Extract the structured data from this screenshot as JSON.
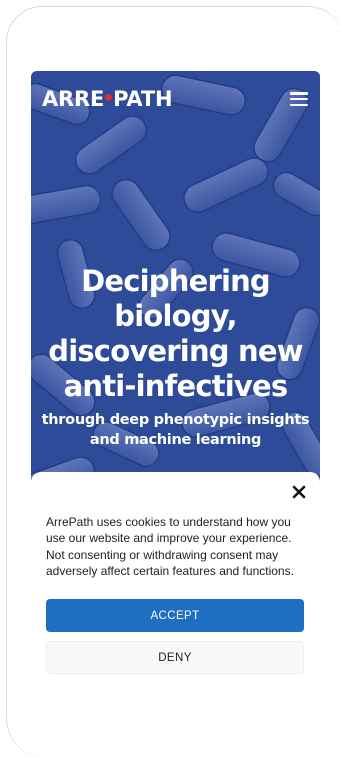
{
  "header": {
    "logo_left": "ARRE",
    "logo_right": "PATH",
    "menu_icon": "hamburger-menu-icon"
  },
  "hero": {
    "title": "Deciphering biology, discovering new anti-infectives",
    "subtitle": "through deep phenotypic insights and machine learning",
    "background": "bacteria-micrograph"
  },
  "cookie_banner": {
    "message": "ArrePath uses cookies to understand how you use our website and improve your experience. Not consenting or withdrawing consent may adversely affect certain features and functions.",
    "accept_label": "ACCEPT",
    "deny_label": "DENY",
    "close_icon": "close-icon"
  },
  "colors": {
    "hero_bg": "#2f4f9c",
    "logo_dot": "#e8283b",
    "accept_bg": "#1e6fc2",
    "deny_bg": "#f9f9f9"
  }
}
